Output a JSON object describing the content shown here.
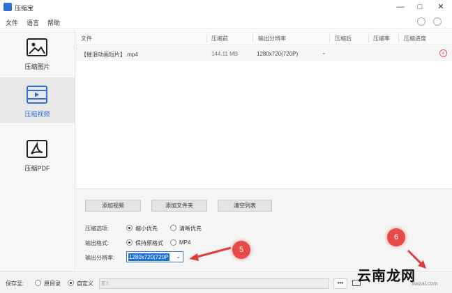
{
  "window": {
    "title": "压缩宝",
    "minimize": "—",
    "maximize": "□",
    "close": "✕"
  },
  "menu": {
    "items": [
      "文件",
      "语言",
      "帮助"
    ],
    "user_icon": "user-icon",
    "chat_icon": "chat-icon"
  },
  "sidebar": {
    "items": [
      {
        "label": "压缩图片",
        "icon": "image-icon",
        "active": false
      },
      {
        "label": "压缩视频",
        "icon": "video-icon",
        "active": true
      },
      {
        "label": "压缩PDF",
        "icon": "pdf-icon",
        "active": false
      }
    ]
  },
  "table": {
    "columns": [
      "文件",
      "压缩前",
      "输出分辨率",
      "压缩后",
      "压缩率",
      "压缩进度"
    ],
    "rows": [
      {
        "file": "【催泪动画短片】.mp4",
        "before": "144.11 MB",
        "resolution": "1280x720(720P)",
        "after": "",
        "ratio": "",
        "progress": ""
      }
    ]
  },
  "actions": {
    "add_video": "添加视频",
    "add_folder": "添加文件夹",
    "clear_list": "清空列表"
  },
  "options": {
    "compress_label": "压缩选项:",
    "compress_small": "缩小优先",
    "compress_clear": "清晰优先",
    "format_label": "输出格式:",
    "format_keep": "保持原格式",
    "format_mp4": "MP4",
    "resolution_label": "输出分辨率:",
    "resolution_value": "1280x720(720P"
  },
  "annotations": {
    "step5": "5",
    "step6": "6",
    "accent": "#e84a4a"
  },
  "save": {
    "label": "保存至:",
    "original_dir": "原目录",
    "custom": "自定义",
    "path": "E:\\",
    "browse": "•••"
  },
  "watermark": {
    "zh": "云南龙网",
    "en": "xiazai.com"
  }
}
